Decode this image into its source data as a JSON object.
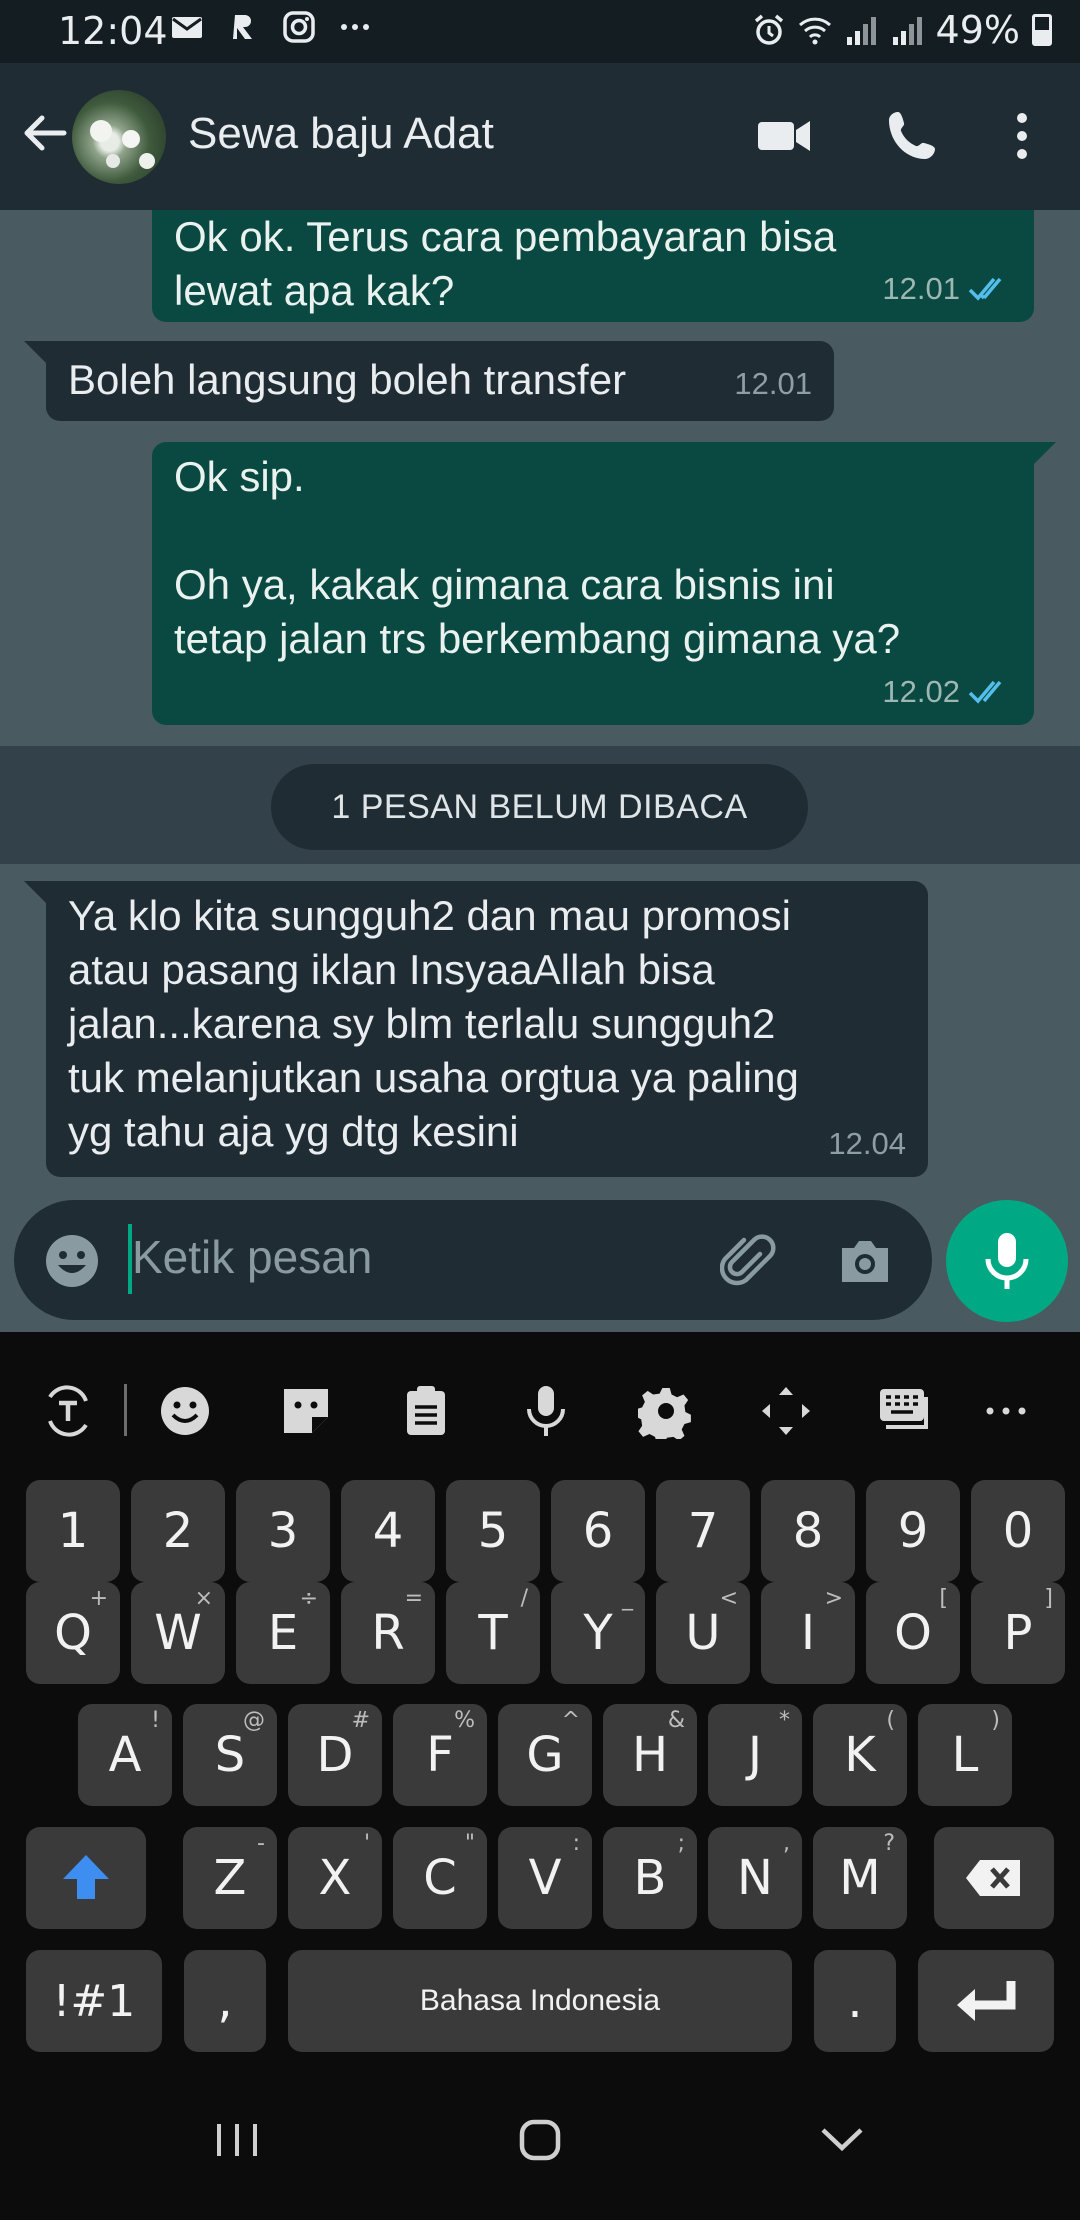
{
  "status_bar": {
    "time": "12:04",
    "battery": "49%"
  },
  "header": {
    "contact_name": "Sewa baju Adat"
  },
  "messages": [
    {
      "direction": "out",
      "lines": [
        "Ok ok. Terus cara pembayaran bisa",
        "lewat apa kak?"
      ],
      "time": "12.01",
      "status": "read"
    },
    {
      "direction": "in",
      "lines": [
        "Boleh langsung boleh transfer"
      ],
      "time": "12.01"
    },
    {
      "direction": "out",
      "lines": [
        "Ok sip.",
        "",
        "Oh ya, kakak gimana cara bisnis ini",
        "tetap jalan trs berkembang gimana ya?"
      ],
      "time": "12.02",
      "status": "read"
    },
    {
      "direction": "in",
      "lines": [
        "Ya klo kita sungguh2 dan mau promosi",
        "atau pasang iklan InsyaaAllah bisa",
        "jalan...karena sy blm terlalu sungguh2",
        "tuk melanjutkan usaha orgtua ya paling",
        "yg tahu aja yg dtg kesini"
      ],
      "time": "12.04"
    }
  ],
  "unread_banner": "1 PESAN BELUM DIBACA",
  "composer": {
    "placeholder": "Ketik pesan"
  },
  "keyboard": {
    "number_row": [
      "1",
      "2",
      "3",
      "4",
      "5",
      "6",
      "7",
      "8",
      "9",
      "0"
    ],
    "row1": [
      {
        "label": "Q",
        "hint": "+"
      },
      {
        "label": "W",
        "hint": "×"
      },
      {
        "label": "E",
        "hint": "÷"
      },
      {
        "label": "R",
        "hint": "="
      },
      {
        "label": "T",
        "hint": "/"
      },
      {
        "label": "Y",
        "hint": "_"
      },
      {
        "label": "U",
        "hint": "<"
      },
      {
        "label": "I",
        "hint": ">"
      },
      {
        "label": "O",
        "hint": "["
      },
      {
        "label": "P",
        "hint": "]"
      }
    ],
    "row2": [
      {
        "label": "A",
        "hint": "!"
      },
      {
        "label": "S",
        "hint": "@"
      },
      {
        "label": "D",
        "hint": "#"
      },
      {
        "label": "F",
        "hint": "%"
      },
      {
        "label": "G",
        "hint": "^"
      },
      {
        "label": "H",
        "hint": "&"
      },
      {
        "label": "J",
        "hint": "*"
      },
      {
        "label": "K",
        "hint": "("
      },
      {
        "label": "L",
        "hint": ")"
      }
    ],
    "row3": [
      {
        "label": "Z",
        "hint": "-"
      },
      {
        "label": "X",
        "hint": "'"
      },
      {
        "label": "C",
        "hint": "\""
      },
      {
        "label": "V",
        "hint": ":"
      },
      {
        "label": "B",
        "hint": ";"
      },
      {
        "label": "N",
        "hint": ","
      },
      {
        "label": "M",
        "hint": "?"
      }
    ],
    "symbols_key": "!#1",
    "comma_key": ",",
    "space_label": "Bahasa Indonesia",
    "period_key": "."
  },
  "colors": {
    "accent": "#00a884",
    "outgoing_bubble": "#0a4941",
    "incoming_bubble": "#1f2c34",
    "read_ticks": "#53bdeb",
    "shift_arrow": "#3d8ef0"
  }
}
